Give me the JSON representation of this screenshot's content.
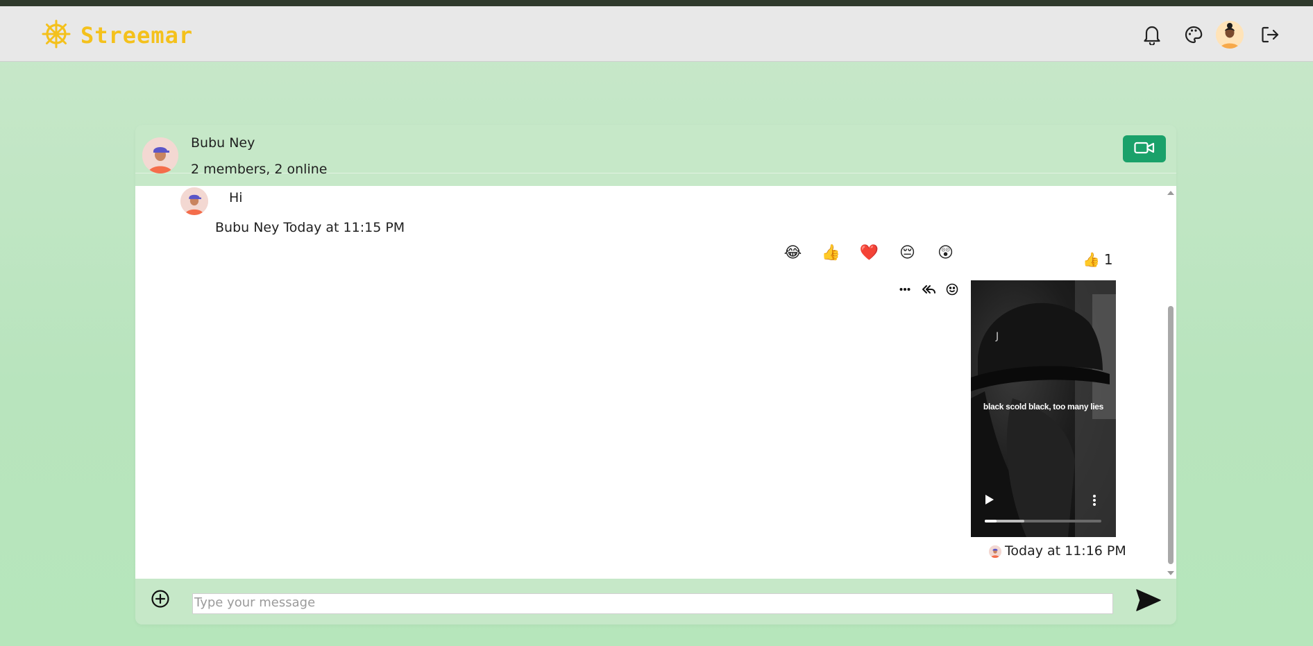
{
  "app": {
    "brand": "Streemar",
    "brand_icon": "dharma-wheel-icon",
    "brand_color": "#f4c11c"
  },
  "navbar": {
    "icons": [
      "bell-icon",
      "palette-icon",
      "avatar",
      "logout-icon"
    ]
  },
  "chat": {
    "channel_name": "Bubu Ney",
    "status": "2 members, 2 online",
    "video_button_color": "#1aa16a",
    "messages": [
      {
        "sender": "Bubu Ney",
        "text": "Hi",
        "meta": "Bubu Ney Today at 11:15 PM"
      },
      {
        "type": "video",
        "caption": "black scold black, too many lies",
        "time": "Today at 11:16 PM",
        "reaction_summary": {
          "emoji": "👍",
          "count": "1"
        },
        "progress": 0.1,
        "buffered": 0.34
      }
    ],
    "reaction_picker": [
      "😂",
      "👍",
      "❤️",
      "😔",
      "😲"
    ],
    "actions": [
      "more-icon",
      "reply-icon",
      "smiley-icon"
    ]
  },
  "composer": {
    "placeholder": "Type your message",
    "value": ""
  }
}
